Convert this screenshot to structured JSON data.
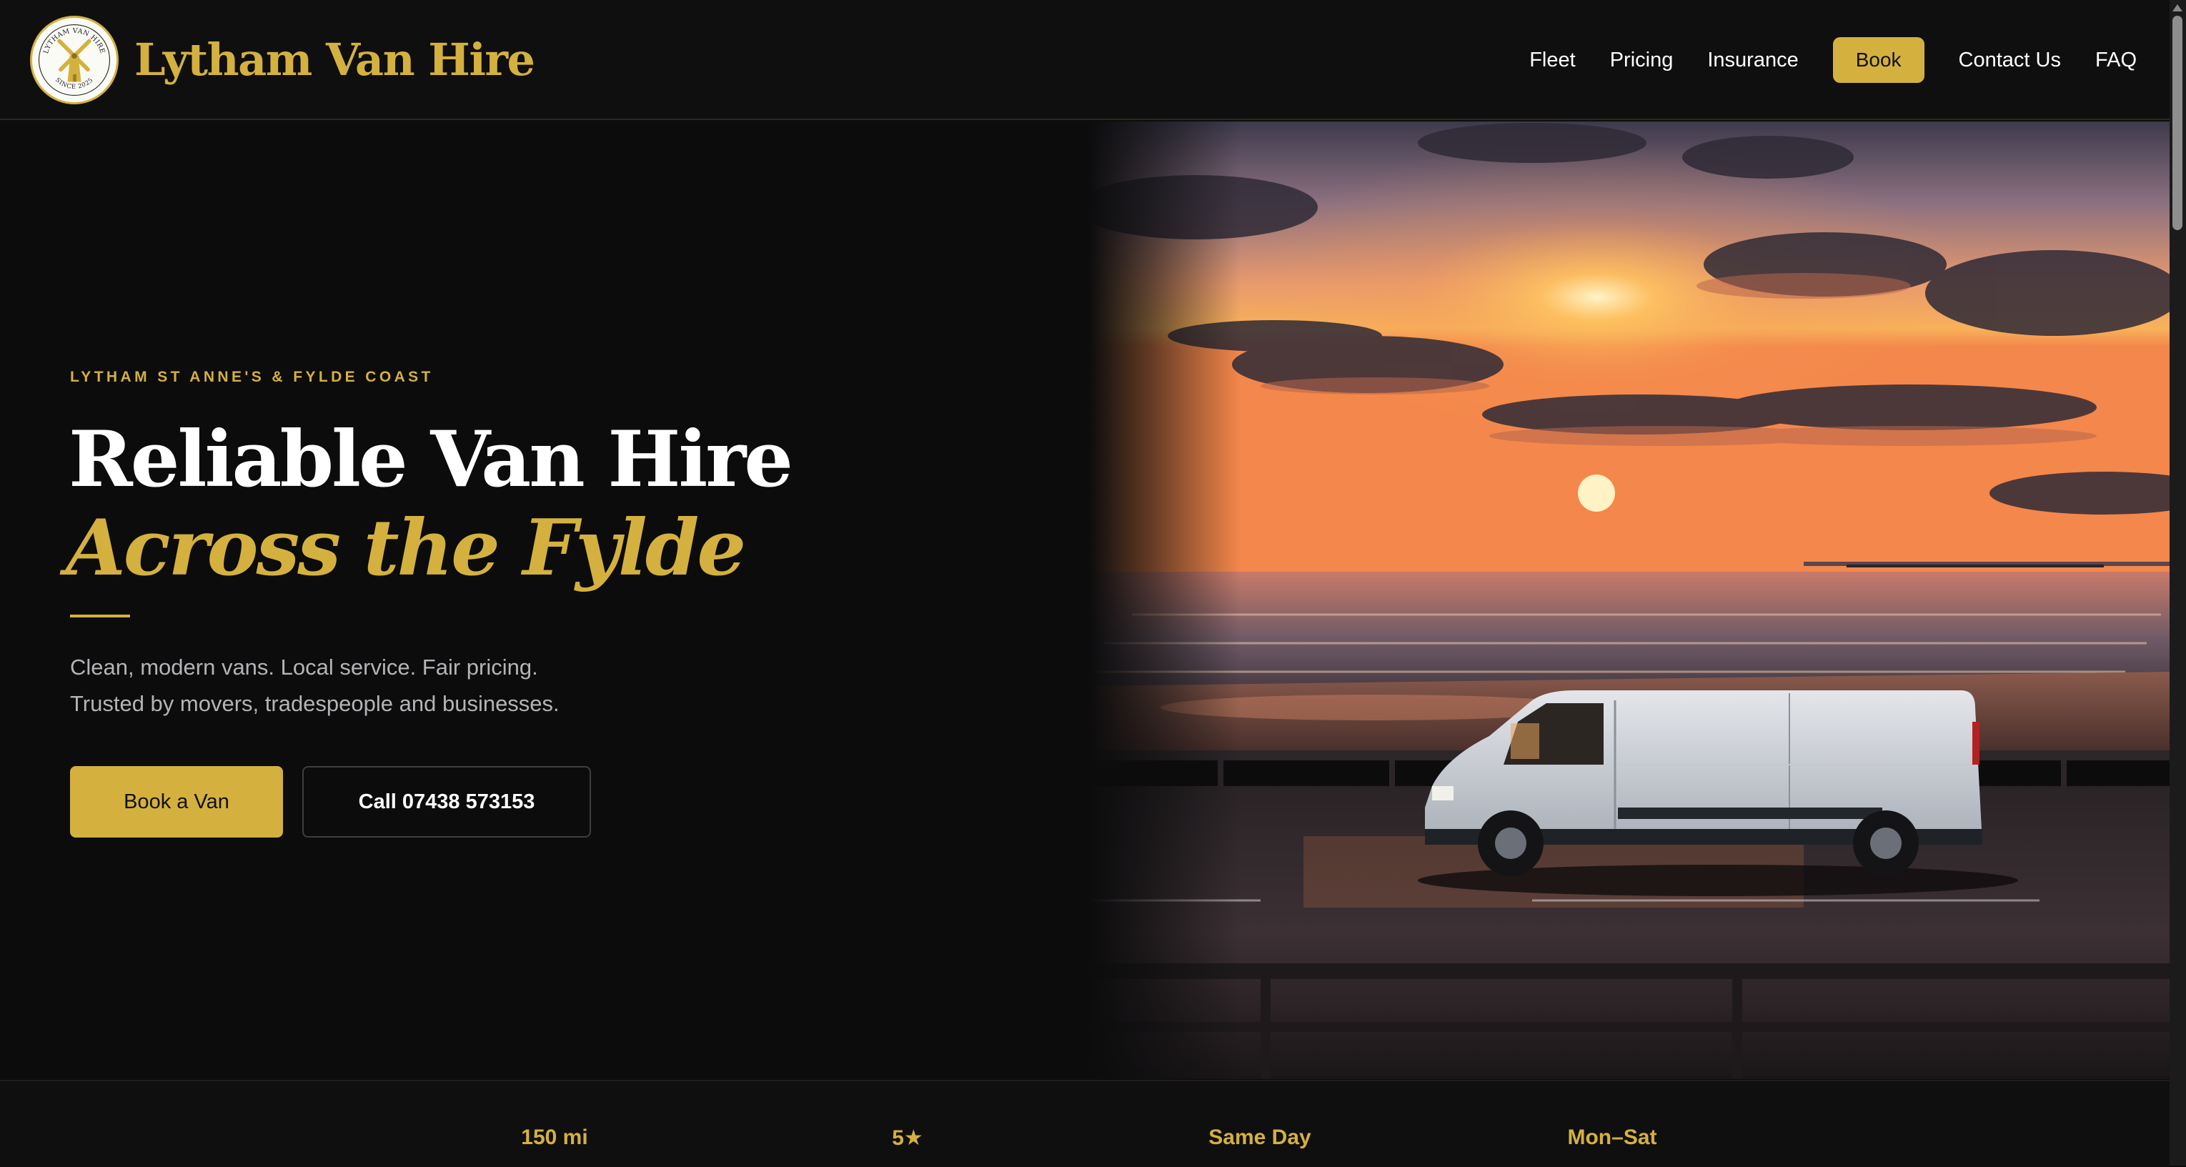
{
  "brand": {
    "name": "Lytham Van Hire",
    "badge_top": "LYTHAM VAN HIRE",
    "badge_bottom": "SINCE 2025"
  },
  "nav": {
    "items": [
      "Fleet",
      "Pricing",
      "Insurance",
      "Book",
      "Contact Us",
      "FAQ"
    ]
  },
  "hero": {
    "eyebrow": "LYTHAM ST ANNE'S & FYLDE COAST",
    "headline_line1": "Reliable Van Hire",
    "headline_line2": "Across the Fylde",
    "sub_line1": "Clean, modern vans. Local service. Fair pricing.",
    "sub_line2": "Trusted by movers, tradespeople and businesses.",
    "cta_primary": "Book a Van",
    "cta_secondary": "Call 07438 573153",
    "image_alt": "Van parked on seafront promenade at sunset"
  },
  "stats": [
    "150 mi",
    "5★",
    "Same Day",
    "Mon–Sat"
  ],
  "colors": {
    "accent": "#d4b13f",
    "background": "#0c0c0d",
    "text": "#ffffff",
    "muted": "#b4b4b8"
  }
}
